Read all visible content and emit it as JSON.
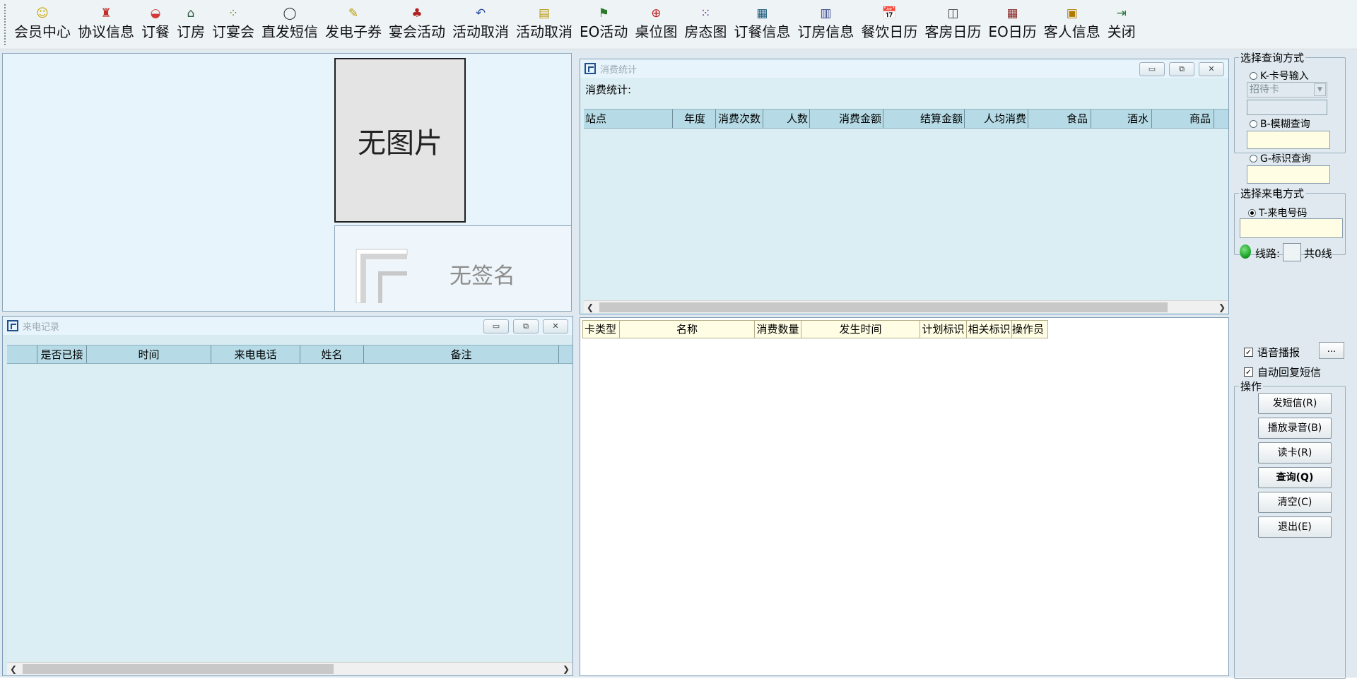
{
  "toolbar": {
    "items": [
      {
        "label": "会员中心",
        "icon": "smiley-icon",
        "glyph": "☺",
        "color": "#c9a800"
      },
      {
        "label": "协议信息",
        "icon": "stamp-icon",
        "glyph": "♜",
        "color": "#c0302a"
      },
      {
        "label": "订餐",
        "icon": "dish-icon",
        "glyph": "◒",
        "color": "#d03a3a"
      },
      {
        "label": "订房",
        "icon": "building-icon",
        "glyph": "⌂",
        "color": "#2a5c3c"
      },
      {
        "label": "订宴会",
        "icon": "banquet-icon",
        "glyph": "⁘",
        "color": "#6f8a2a"
      },
      {
        "label": "直发短信",
        "icon": "speech-bubble-icon",
        "glyph": "◯",
        "color": "#333333"
      },
      {
        "label": "发电子券",
        "icon": "coupon-icon",
        "glyph": "✎",
        "color": "#b89a00"
      },
      {
        "label": "宴会活动",
        "icon": "people-icon",
        "glyph": "♣",
        "color": "#b02020"
      },
      {
        "label": "活动取消",
        "icon": "undo-icon",
        "glyph": "↶",
        "color": "#2a4ca0"
      },
      {
        "label": "活动取消",
        "icon": "document-icon",
        "glyph": "▤",
        "color": "#b8960a"
      },
      {
        "label": "EO活动",
        "icon": "flag-icon",
        "glyph": "⚑",
        "color": "#2a7a2a"
      },
      {
        "label": "桌位图",
        "icon": "table-seat-icon",
        "glyph": "⊕",
        "color": "#c02020"
      },
      {
        "label": "房态图",
        "icon": "grid-dots-icon",
        "glyph": "⁙",
        "color": "#7a2aa0"
      },
      {
        "label": "订餐信息",
        "icon": "spreadsheet-icon",
        "glyph": "▦",
        "color": "#1a5a7a"
      },
      {
        "label": "订房信息",
        "icon": "room-grid-icon",
        "glyph": "▥",
        "color": "#3a4a8a"
      },
      {
        "label": "餐饮日历",
        "icon": "calendar-icon",
        "glyph": "📅",
        "color": "#2a5caa"
      },
      {
        "label": "客房日历",
        "icon": "room-calendar-icon",
        "glyph": "◫",
        "color": "#444444"
      },
      {
        "label": "EO日历",
        "icon": "eo-calendar-icon",
        "glyph": "▦",
        "color": "#8a2a2a"
      },
      {
        "label": "客人信息",
        "icon": "guest-card-icon",
        "glyph": "▣",
        "color": "#b07a00"
      },
      {
        "label": "关闭",
        "icon": "exit-door-icon",
        "glyph": "⇥",
        "color": "#2a7a3a"
      }
    ]
  },
  "photo": {
    "no_photo_text": "无图片",
    "no_signature_text": "无签名"
  },
  "call_log": {
    "title": "来电记录",
    "columns": [
      "",
      "是否已接",
      "时间",
      "来电电话",
      "姓名",
      "备注",
      ""
    ]
  },
  "consume": {
    "title": "消费统计",
    "caption": "消费统计:",
    "columns": [
      "站点",
      "年度",
      "消费次数",
      "人数",
      "消费金额",
      "结算金额",
      "人均消费",
      "食品",
      "酒水",
      "商品"
    ]
  },
  "detail": {
    "columns": [
      "卡类型",
      "名称",
      "消费数量",
      "发生时间",
      "计划标识",
      "相关标识",
      "操作员"
    ]
  },
  "window_buttons": {
    "minimize": "▭",
    "restore": "⧉",
    "close": "✕"
  },
  "query": {
    "legend": "选择查询方式",
    "option_card": "K-卡号输入",
    "card_select_value": "招待卡",
    "option_fuzzy": "B-模糊查询",
    "option_tag": "G-标识查询"
  },
  "incoming": {
    "legend": "选择来电方式",
    "option_phone": "T-来电号码",
    "line_label": "线路:",
    "line_total": "共0线"
  },
  "options": {
    "voice_label": "语音播报",
    "voice_checked": true,
    "ellipsis_label": "...",
    "auto_sms_label": "自动回复短信",
    "auto_sms_checked": true
  },
  "operations": {
    "legend": "操作",
    "send_sms": "发短信(R)",
    "play_recording": "播放录音(B)",
    "read_card": "读卡(R)",
    "query": "查询(Q)",
    "clear": "清空(C)",
    "exit": "退出(E)"
  },
  "colors": {
    "header_bg": "#b6dbe6",
    "panel_bg": "#dbeef3",
    "input_bg": "#fffde3",
    "status_led": "#1fa82c"
  }
}
